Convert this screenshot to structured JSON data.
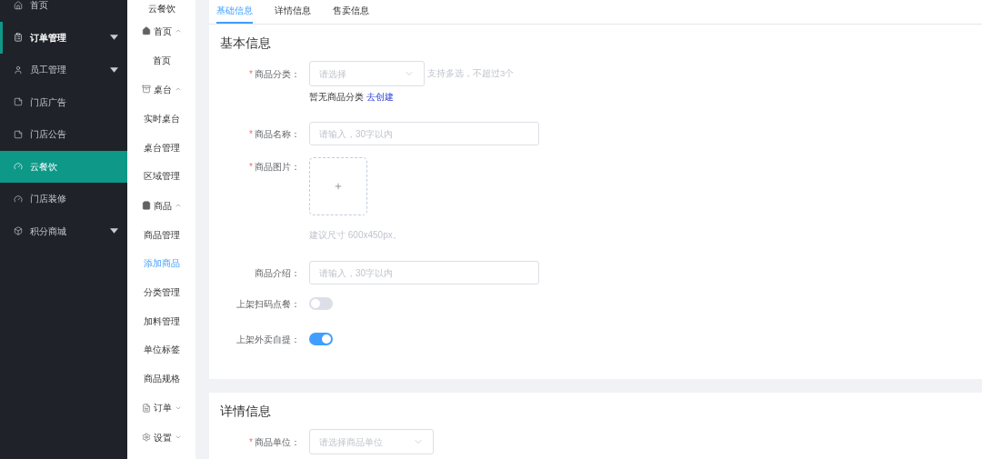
{
  "sidebar": {
    "items": [
      {
        "label": "首页",
        "expandable": false,
        "selected": false,
        "marked": false
      },
      {
        "label": "订单管理",
        "expandable": true,
        "selected": false,
        "marked": true
      },
      {
        "label": "员工管理",
        "expandable": true,
        "selected": false,
        "marked": false
      },
      {
        "label": "门店广告",
        "expandable": false,
        "selected": false,
        "marked": false
      },
      {
        "label": "门店公告",
        "expandable": false,
        "selected": false,
        "marked": false
      },
      {
        "label": "云餐饮",
        "expandable": false,
        "selected": true,
        "marked": false
      },
      {
        "label": "门店装修",
        "expandable": false,
        "selected": false,
        "marked": false
      },
      {
        "label": "积分商城",
        "expandable": true,
        "selected": false,
        "marked": false
      }
    ]
  },
  "submenu": {
    "title": "云餐饮",
    "groups": [
      {
        "label": "首页",
        "expanded": true,
        "items": [
          {
            "label": "首页",
            "selected": false
          }
        ]
      },
      {
        "label": "桌台",
        "expanded": true,
        "items": [
          {
            "label": "实时桌台",
            "selected": false
          },
          {
            "label": "桌台管理",
            "selected": false
          },
          {
            "label": "区域管理",
            "selected": false
          }
        ]
      },
      {
        "label": "商品",
        "expanded": true,
        "items": [
          {
            "label": "商品管理",
            "selected": false
          },
          {
            "label": "添加商品",
            "selected": true
          },
          {
            "label": "分类管理",
            "selected": false
          },
          {
            "label": "加料管理",
            "selected": false
          },
          {
            "label": "单位标签",
            "selected": false
          },
          {
            "label": "商品规格",
            "selected": false
          }
        ]
      },
      {
        "label": "订单",
        "expanded": false
      },
      {
        "label": "设置",
        "expanded": false
      }
    ]
  },
  "tabs": [
    {
      "label": "基础信息",
      "selected": true
    },
    {
      "label": "详情信息",
      "selected": false
    },
    {
      "label": "售卖信息",
      "selected": false
    }
  ],
  "sections": [
    {
      "title": "基本信息",
      "fields": [
        {
          "kind": "select",
          "required_mark": "*",
          "label": "商品分类：",
          "placeholder": "请选择",
          "hint": "支持多选，不超过3个",
          "note": "暂无商品分类",
          "link": "去创建"
        },
        {
          "kind": "input",
          "required_mark": "*",
          "label": "商品名称：",
          "placeholder": "请输入，30字以内"
        },
        {
          "kind": "upload",
          "required_mark": "*",
          "label": "商品图片：",
          "hint": "建议尺寸 600x450px。"
        },
        {
          "kind": "input",
          "label": "商品介绍：",
          "placeholder": "请输入，30字以内"
        },
        {
          "kind": "switch",
          "label": "上架扫码点餐：",
          "on": false
        },
        {
          "kind": "switch",
          "label": "上架外卖自提：",
          "on": true
        }
      ]
    },
    {
      "title": "详情信息",
      "fields": [
        {
          "kind": "select",
          "required_mark": "*",
          "label": "商品单位：",
          "placeholder": "请选择商品单位"
        }
      ]
    }
  ]
}
